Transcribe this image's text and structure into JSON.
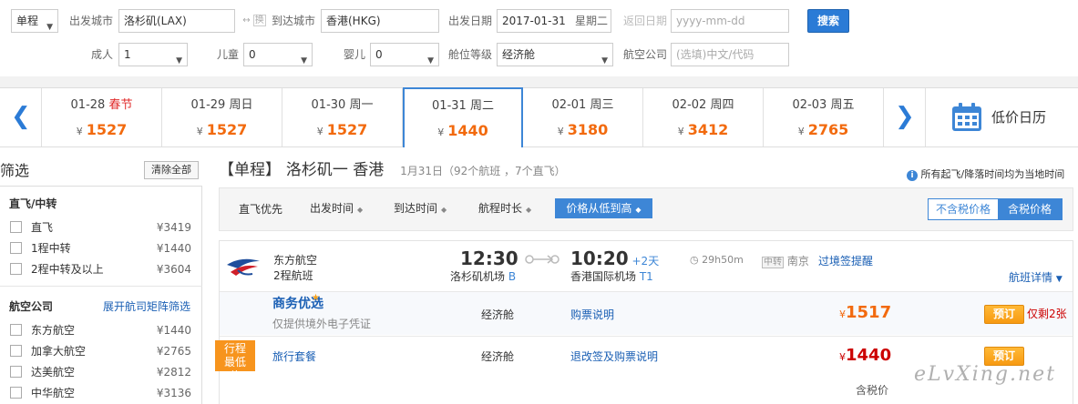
{
  "search": {
    "trip_type": "单程",
    "depart_city_label": "出发城市",
    "depart_city": "洛杉矶(LAX)",
    "swap_label": "换",
    "arrive_city_label": "到达城市",
    "arrive_city": "香港(HKG)",
    "depart_date_label": "出发日期",
    "depart_date": "2017-01-31",
    "depart_weekday": "星期二",
    "return_date_label": "返回日期",
    "return_date_placeholder": "yyyy-mm-dd",
    "search_button": "搜索",
    "adult_label": "成人",
    "adult_value": "1",
    "child_label": "儿童",
    "child_value": "0",
    "infant_label": "婴儿",
    "infant_value": "0",
    "cabin_label": "舱位等级",
    "cabin_value": "经济舱",
    "airline_label": "航空公司",
    "airline_placeholder": "(选填)中文/代码"
  },
  "datebar": {
    "currency": "¥",
    "dates": [
      {
        "date": "01-28",
        "day": "春节",
        "price": "1527",
        "holiday": true
      },
      {
        "date": "01-29",
        "day": "周日",
        "price": "1527"
      },
      {
        "date": "01-30",
        "day": "周一",
        "price": "1527"
      },
      {
        "date": "01-31",
        "day": "周二",
        "price": "1440",
        "active": true
      },
      {
        "date": "02-01",
        "day": "周三",
        "price": "3180"
      },
      {
        "date": "02-02",
        "day": "周四",
        "price": "3412"
      },
      {
        "date": "02-03",
        "day": "周五",
        "price": "2765"
      }
    ],
    "calendar_label": "低价日历"
  },
  "filter": {
    "title": "筛选",
    "clear_all": "清除全部",
    "group1_title": "直飞/中转",
    "group1_items": [
      {
        "label": "直飞",
        "price": "¥3419"
      },
      {
        "label": "1程中转",
        "price": "¥1440"
      },
      {
        "label": "2程中转及以上",
        "price": "¥3604"
      }
    ],
    "group2_title": "航空公司",
    "group2_link": "展开航司矩阵筛选",
    "group2_items": [
      {
        "label": "东方航空",
        "price": "¥1440"
      },
      {
        "label": "加拿大航空",
        "price": "¥2765"
      },
      {
        "label": "达美航空",
        "price": "¥2812"
      },
      {
        "label": "中华航空",
        "price": "¥3136"
      }
    ]
  },
  "results": {
    "heading_prefix": "【单程】",
    "heading_route": "洛杉矶一 香港",
    "heading_meta": "1月31日（92个航班 ，7个直飞）",
    "notice": "所有起飞/降落时间均为当地时间",
    "sort": [
      "直飞优先",
      "出发时间",
      "到达时间",
      "航程时长",
      "价格从低到高"
    ],
    "price_toggle": [
      "不含税价格",
      "含税价格"
    ],
    "flight": {
      "airline": "东方航空",
      "stops": "2程航班",
      "depart_time": "12:30",
      "depart_airport": "洛杉矶机场",
      "depart_terminal": "B",
      "arrive_time": "10:20",
      "arrive_plus": "+2天",
      "arrive_airport": "香港国际机场",
      "arrive_terminal": "T1",
      "duration": "29h50m",
      "transfer_tag": "中转",
      "transfer_city": "南京",
      "visa_link": "过境签提醒",
      "detail_link": "航班详情"
    },
    "fares": [
      {
        "brand": "商务优选",
        "note": "仅提供境外电子凭证",
        "cabin": "经济舱",
        "rule_link": "购票说明",
        "price": "1517",
        "book": "预订",
        "remaining": "仅剩2张"
      },
      {
        "badge": "行程最低价",
        "brand": "旅行套餐",
        "cabin": "经济舱",
        "rule_link": "退改签及购票说明",
        "price": "1440",
        "book": "预订",
        "tax_note": "含税价"
      }
    ],
    "currency": "¥"
  },
  "watermark": "eLvXing.net"
}
